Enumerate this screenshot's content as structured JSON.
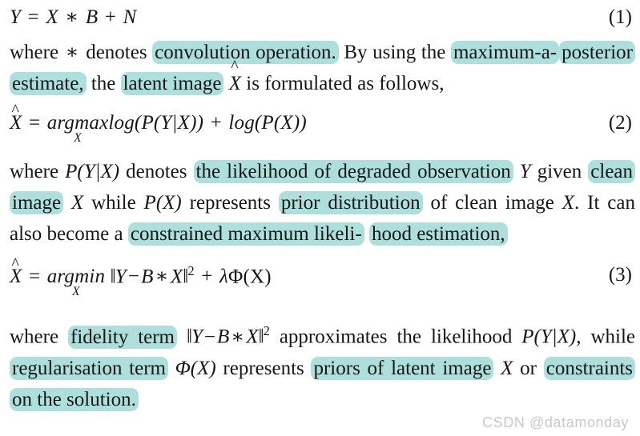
{
  "document": {
    "type": "academic-paper-excerpt",
    "highlight_color": "#ade0dd",
    "text_color": "#161616",
    "background_color": "#ffffff"
  },
  "equations": {
    "eq1": {
      "number": "(1)",
      "latex": "Y = X * B + N",
      "parts": {
        "lhs": "Y",
        "eq": "=",
        "x": "X",
        "conv": "∗",
        "b": "B",
        "plus": "+",
        "n": "N"
      }
    },
    "eq2": {
      "number": "(2)",
      "latex": "\\widehat{X} = \\arg\\max_{X} log(P(Y|X)) + log(P(X))",
      "parts": {
        "xhat": "X",
        "hat": "̂",
        "eq": "=",
        "arg": "arg",
        "op": "max",
        "limit": "X",
        "term1": "log(P(Y|X))",
        "plus": "+",
        "term2": "log(P(X))"
      }
    },
    "eq3": {
      "number": "(3)",
      "latex": "\\widehat{X} = \\arg\\min_{X} \\|Y - B * X\\|^{2} + \\lambda\\Phi(X)",
      "parts": {
        "xhat": "X",
        "hat": "̂",
        "eq": "=",
        "arg": "arg",
        "op": "min",
        "limit": "X",
        "normopen": "‖",
        "y": "Y",
        "minus": "−",
        "b": "B",
        "conv": "∗",
        "x": "X",
        "normclose": "‖",
        "power": "2",
        "plus": "+",
        "lambda": "λ",
        "phi": "Φ(X)"
      }
    }
  },
  "paragraphs": {
    "p1": {
      "t1": "where ",
      "conv_symbol": "∗",
      "t2": " denotes ",
      "hl1": "convolution operation.",
      "t3": " By using the ",
      "hl2": "maximum-a-",
      "hl3": "posterior",
      "t4": " ",
      "hl4": "estimate,",
      "t5": " the ",
      "hl5": "latent image",
      "t6": " ",
      "xhat": "X",
      "hat": "̂",
      "t7": " is formulated as follows,"
    },
    "p2": {
      "t1": "where ",
      "m1": "P(Y|X)",
      "t2": " denotes ",
      "hl1": "the likelihood of degraded observation",
      "t3": " ",
      "m2": "Y",
      "t4": " given ",
      "hl2": "clean image",
      "t5": " ",
      "m3": "X",
      "t6": " while ",
      "m4": "P(X)",
      "t7": " represents ",
      "hl3": "prior distribution",
      "t8": " of clean image ",
      "m5": "X",
      "t9": ". It can also become a ",
      "hl4": "constrained maximum likeli-",
      "hl5": "hood estimation,"
    },
    "p3": {
      "t1": "where ",
      "hl1": "fidelity term",
      "t2": " ",
      "normopen": "‖",
      "y": "Y",
      "minus": "−",
      "b": "B",
      "conv": "∗",
      "x": "X",
      "normclose": "‖",
      "power": "2",
      "t3": " approximates the likelihood ",
      "m1": "P(Y|X)",
      "t4": ", while ",
      "hl2": "regularisation term",
      "t5": " ",
      "m2": "Φ(X)",
      "t6": " represents ",
      "hl3": "priors of latent image",
      "t7": " ",
      "m3": "X",
      "t8": " or ",
      "hl4": "constraints on the solution."
    }
  },
  "watermark": {
    "text": "CSDN @datamonday"
  }
}
